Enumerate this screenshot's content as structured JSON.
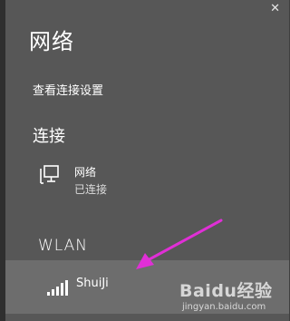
{
  "flyout": {
    "title": "网络",
    "view_settings_link": "查看连接设置",
    "close_glyph": "✕"
  },
  "connections": {
    "heading": "连接",
    "items": [
      {
        "name": "网络",
        "status": "已连接",
        "icon": "wired-network-icon"
      }
    ]
  },
  "wlan": {
    "heading": "WLAN",
    "networks": [
      {
        "ssid": "ShuiJi",
        "icon": "wifi-signal-icon",
        "signal_bars": 5,
        "highlighted": true
      }
    ]
  },
  "annotation": {
    "color": "#e02fd6"
  },
  "watermark": {
    "logo": "Baidu经验",
    "url": "jingyan.baidu.com"
  }
}
